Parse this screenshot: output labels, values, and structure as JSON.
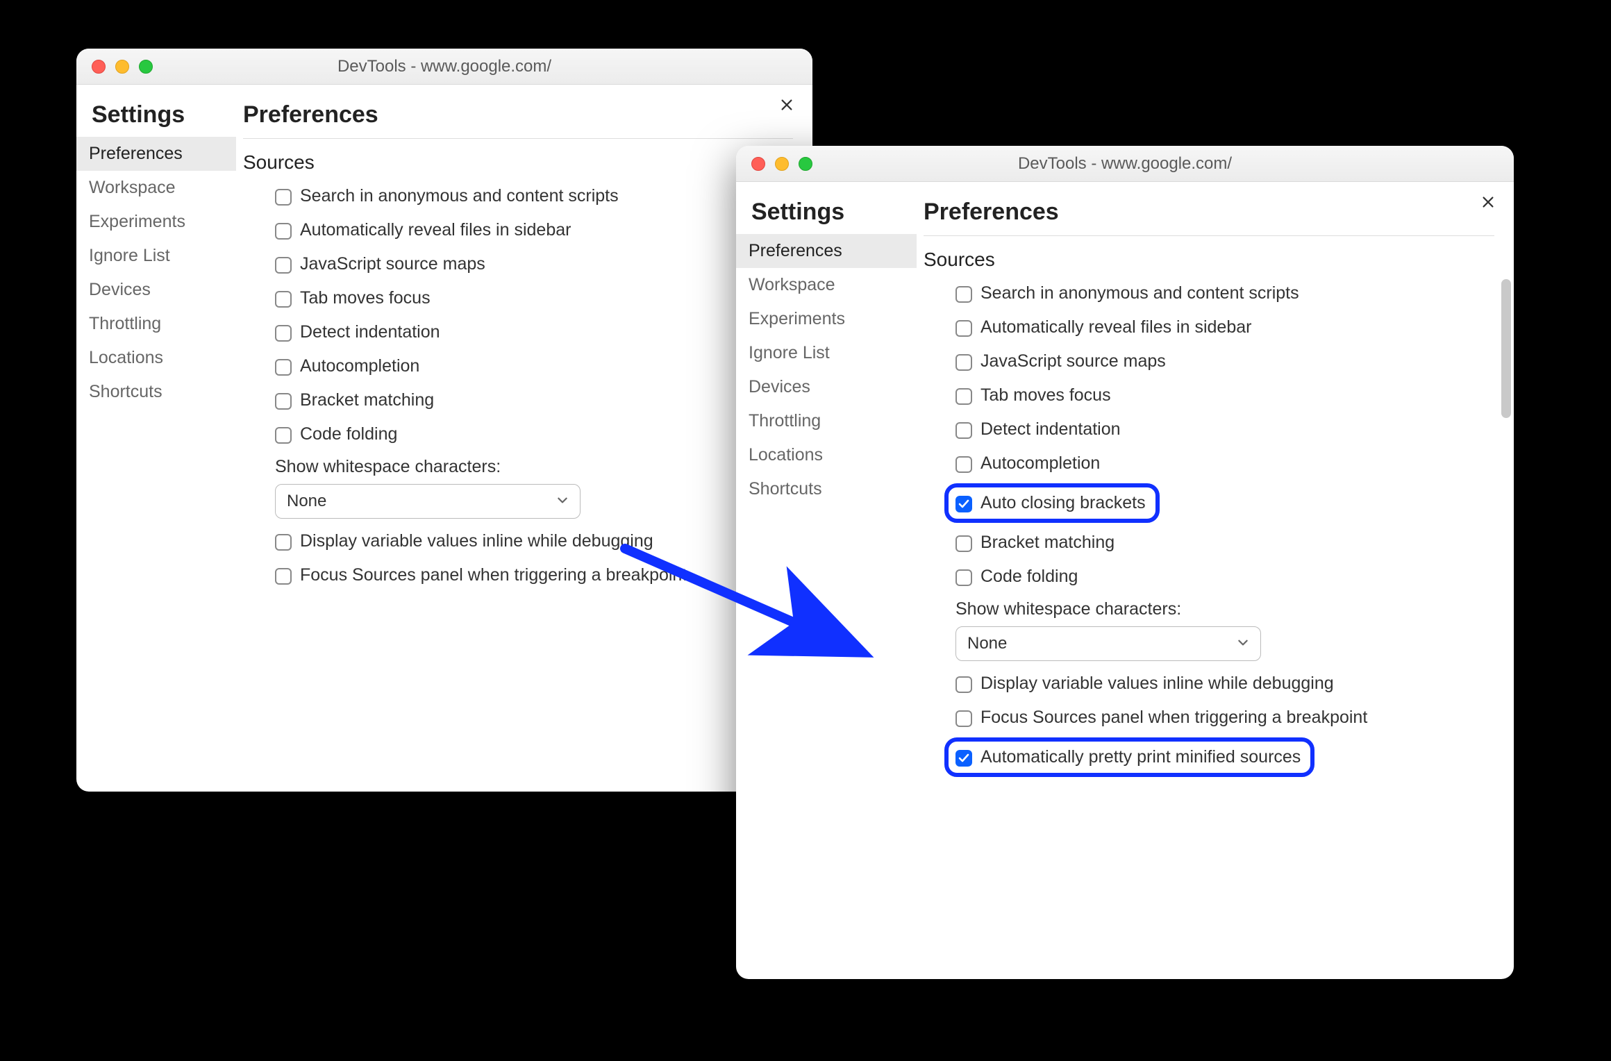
{
  "accent": "#1030ff",
  "w1": {
    "title": "DevTools - www.google.com/",
    "settings_title": "Settings",
    "main_title": "Preferences",
    "section": "Sources",
    "sidebar": [
      {
        "label": "Preferences",
        "active": true
      },
      {
        "label": "Workspace",
        "active": false
      },
      {
        "label": "Experiments",
        "active": false
      },
      {
        "label": "Ignore List",
        "active": false
      },
      {
        "label": "Devices",
        "active": false
      },
      {
        "label": "Throttling",
        "active": false
      },
      {
        "label": "Locations",
        "active": false
      },
      {
        "label": "Shortcuts",
        "active": false
      }
    ],
    "options": [
      {
        "label": "Search in anonymous and content scripts",
        "checked": false
      },
      {
        "label": "Automatically reveal files in sidebar",
        "checked": false
      },
      {
        "label": "JavaScript source maps",
        "checked": false
      },
      {
        "label": "Tab moves focus",
        "checked": false
      },
      {
        "label": "Detect indentation",
        "checked": false
      },
      {
        "label": "Autocompletion",
        "checked": false
      },
      {
        "label": "Bracket matching",
        "checked": false
      },
      {
        "label": "Code folding",
        "checked": false
      }
    ],
    "select": {
      "label": "Show whitespace characters:",
      "value": "None"
    },
    "options_after": [
      {
        "label": "Display variable values inline while debugging",
        "checked": false
      },
      {
        "label": "Focus Sources panel when triggering a breakpoint",
        "checked": false
      }
    ]
  },
  "w2": {
    "title": "DevTools - www.google.com/",
    "settings_title": "Settings",
    "main_title": "Preferences",
    "section": "Sources",
    "sidebar": [
      {
        "label": "Preferences",
        "active": true
      },
      {
        "label": "Workspace",
        "active": false
      },
      {
        "label": "Experiments",
        "active": false
      },
      {
        "label": "Ignore List",
        "active": false
      },
      {
        "label": "Devices",
        "active": false
      },
      {
        "label": "Throttling",
        "active": false
      },
      {
        "label": "Locations",
        "active": false
      },
      {
        "label": "Shortcuts",
        "active": false
      }
    ],
    "options": [
      {
        "label": "Search in anonymous and content scripts",
        "checked": false,
        "hl": false
      },
      {
        "label": "Automatically reveal files in sidebar",
        "checked": false,
        "hl": false
      },
      {
        "label": "JavaScript source maps",
        "checked": false,
        "hl": false
      },
      {
        "label": "Tab moves focus",
        "checked": false,
        "hl": false
      },
      {
        "label": "Detect indentation",
        "checked": false,
        "hl": false
      },
      {
        "label": "Autocompletion",
        "checked": false,
        "hl": false
      },
      {
        "label": "Auto closing brackets",
        "checked": true,
        "hl": true
      },
      {
        "label": "Bracket matching",
        "checked": false,
        "hl": false
      },
      {
        "label": "Code folding",
        "checked": false,
        "hl": false
      }
    ],
    "select": {
      "label": "Show whitespace characters:",
      "value": "None"
    },
    "options_after": [
      {
        "label": "Display variable values inline while debugging",
        "checked": false,
        "hl": false
      },
      {
        "label": "Focus Sources panel when triggering a breakpoint",
        "checked": false,
        "hl": false
      },
      {
        "label": "Automatically pretty print minified sources",
        "checked": true,
        "hl": true
      }
    ]
  }
}
